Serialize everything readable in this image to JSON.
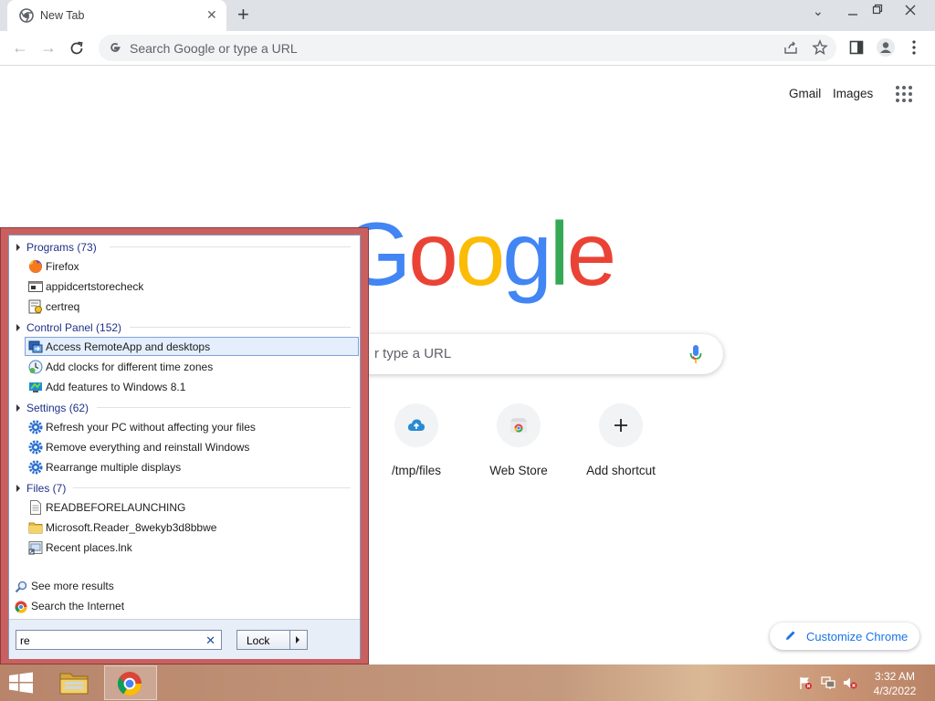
{
  "browser": {
    "tab_title": "New Tab",
    "omnibox_placeholder": "Search Google or type a URL"
  },
  "ntp": {
    "gmail": "Gmail",
    "images": "Images",
    "logo_letters": [
      "G",
      "o",
      "o",
      "g",
      "l",
      "e"
    ],
    "logo_colors": [
      "#4285f4",
      "#ea4335",
      "#fbbc05",
      "#4285f4",
      "#34a853",
      "#ea4335"
    ],
    "search_placeholder_visible": "r type a URL",
    "shortcuts": [
      {
        "label": "/tmp/files",
        "icon": "cloud-upload-icon"
      },
      {
        "label": "Web Store",
        "icon": "web-store-icon"
      },
      {
        "label": "Add shortcut",
        "icon": "plus-icon"
      }
    ],
    "customize": "Customize Chrome"
  },
  "start_search": {
    "groups": [
      {
        "title": "Programs (73)",
        "items": [
          {
            "label": "Firefox",
            "icon": "firefox-icon"
          },
          {
            "label": "appidcertstorecheck",
            "icon": "console-icon"
          },
          {
            "label": "certreq",
            "icon": "certificate-icon"
          }
        ]
      },
      {
        "title": "Control Panel (152)",
        "items": [
          {
            "label": "Access RemoteApp and desktops",
            "icon": "remoteapp-icon",
            "selected": true
          },
          {
            "label": "Add clocks for different time zones",
            "icon": "clock-icon"
          },
          {
            "label": "Add features to Windows 8.1",
            "icon": "windows-features-icon"
          }
        ]
      },
      {
        "title": "Settings (62)",
        "items": [
          {
            "label": "Refresh your PC without affecting your files",
            "icon": "settings-gear-icon"
          },
          {
            "label": "Remove everything and reinstall Windows",
            "icon": "settings-gear-icon"
          },
          {
            "label": "Rearrange multiple displays",
            "icon": "settings-gear-icon"
          }
        ]
      },
      {
        "title": "Files (7)",
        "items": [
          {
            "label": "READBEFORELAUNCHING",
            "icon": "text-file-icon"
          },
          {
            "label": "Microsoft.Reader_8wekyb3d8bbwe",
            "icon": "folder-icon"
          },
          {
            "label": "Recent places.lnk",
            "icon": "shortcut-file-icon"
          }
        ]
      }
    ],
    "see_more": "See more results",
    "search_internet": "Search the Internet",
    "query": "re",
    "lock_label": "Lock"
  },
  "taskbar": {
    "time": "3:32 AM",
    "date": "4/3/2022"
  }
}
